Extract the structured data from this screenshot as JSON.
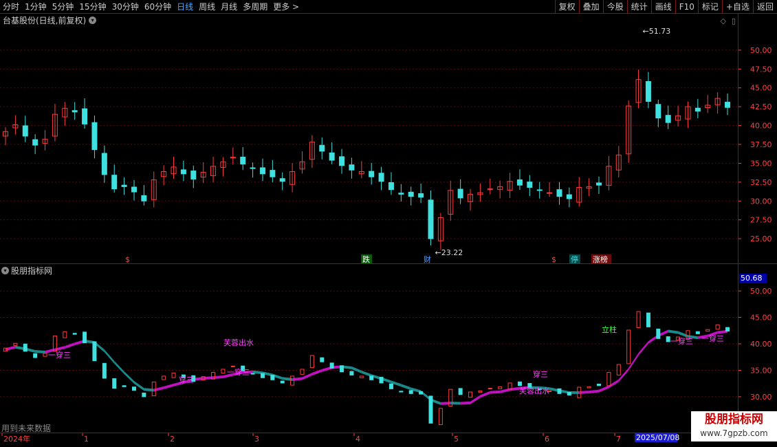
{
  "toolbar": {
    "left_items": [
      {
        "label": "分时"
      },
      {
        "label": "1分钟"
      },
      {
        "label": "5分钟"
      },
      {
        "label": "15分钟"
      },
      {
        "label": "30分钟"
      },
      {
        "label": "60分钟"
      },
      {
        "label": "日线",
        "active": true
      },
      {
        "label": "周线"
      },
      {
        "label": "月线"
      },
      {
        "label": "多周期"
      },
      {
        "label": "更多 >"
      }
    ],
    "right_items": [
      "复权",
      "叠加",
      "今股",
      "统计",
      "画线",
      "F10",
      "标记",
      "+自选",
      "返回"
    ]
  },
  "main_chart": {
    "title": "台基股份(日线,前复权)",
    "high_label": "51.73",
    "low_label": "23.22",
    "y_ticks": [
      "50.00",
      "47.50",
      "45.00",
      "42.50",
      "40.00",
      "37.50",
      "35.00",
      "32.50",
      "30.00",
      "27.50",
      "25.00"
    ],
    "event_markers": [
      "$",
      "跌",
      "财",
      "$",
      "停",
      "涨榜"
    ]
  },
  "indicator": {
    "title": "股朋指标网",
    "value_box": "50.68",
    "y_ticks": [
      "50.00",
      "45.00",
      "40.00",
      "35.00",
      "30.00"
    ],
    "labels": [
      "一穿三",
      "芙蓉出水",
      "穿三",
      "一穿三",
      "穿三",
      "芙蓉出水",
      "一穿三",
      "立柱",
      "一穿三",
      "一穿三"
    ],
    "future_note": "用到未来数据"
  },
  "x_axis": {
    "labels": [
      "2024年",
      "1",
      "2",
      "3",
      "4",
      "5",
      "6",
      "7"
    ],
    "current_date": "2025/07/08"
  },
  "watermark": {
    "title": "股朋指标网",
    "url": "www.7gpzb.com"
  },
  "colors": {
    "up": "#ff3b3b",
    "down": "#3fe0e0",
    "frame": "#7a1a1a",
    "ribbon_up": "#c010c0",
    "ribbon_down": "#1a8a8a",
    "accent_blue": "#4ea6ff"
  },
  "chart_data": [
    {
      "type": "candlestick",
      "title": "台基股份(日线,前复权)",
      "ylim": [
        22,
        53
      ],
      "annotations": [
        {
          "label": "51.73",
          "type": "high"
        },
        {
          "label": "23.22",
          "type": "low"
        }
      ],
      "close": [
        39.2,
        40.1,
        38.6,
        37.4,
        38.2,
        41.5,
        42.3,
        41.8,
        40.2,
        36.8,
        33.5,
        31.6,
        31.9,
        31.2,
        30.0,
        32.8,
        33.9,
        34.5,
        33.6,
        32.9,
        33.8,
        34.6,
        35.2,
        35.8,
        34.9,
        34.3,
        33.6,
        33.2,
        32.6,
        33.9,
        35.2,
        37.8,
        36.6,
        35.4,
        34.7,
        34.1,
        33.9,
        33.2,
        32.6,
        31.5,
        30.9,
        30.6,
        30.5,
        25.0,
        27.8,
        31.4,
        30.4,
        30.9,
        31.1,
        31.6,
        31.9,
        32.6,
        32.1,
        31.8,
        31.4,
        31.1,
        30.6,
        30.3,
        31.8,
        31.9,
        32.1,
        34.6,
        36.1,
        42.6,
        46.1,
        43.2,
        41.0,
        40.4,
        41.3,
        42.5,
        41.9,
        42.7,
        43.6,
        42.4
      ]
    },
    {
      "type": "line",
      "title": "股朋指标网",
      "ylim": [
        27,
        53
      ],
      "series": [
        {
          "values": [
            39.2,
            40.1,
            38.6,
            37.4,
            38.2,
            41.5,
            42.3,
            41.8,
            40.2,
            36.8,
            33.5,
            31.6,
            31.9,
            31.2,
            30.0,
            32.8,
            33.9,
            34.5,
            33.6,
            32.9,
            33.8,
            34.6,
            35.2,
            35.8,
            34.9,
            34.3,
            33.6,
            33.2,
            32.6,
            33.9,
            35.2,
            37.8,
            36.6,
            35.4,
            34.7,
            34.1,
            33.9,
            33.2,
            32.6,
            31.5,
            30.9,
            30.6,
            30.5,
            25.0,
            27.8,
            31.4,
            30.4,
            30.9,
            31.1,
            31.6,
            31.9,
            32.6,
            32.1,
            31.8,
            31.4,
            31.1,
            30.6,
            30.3,
            31.8,
            31.9,
            32.1,
            34.6,
            36.1,
            42.6,
            46.1,
            43.2,
            41.0,
            40.4,
            41.3,
            42.5,
            41.9,
            42.7,
            43.6,
            42.4
          ]
        }
      ]
    }
  ]
}
